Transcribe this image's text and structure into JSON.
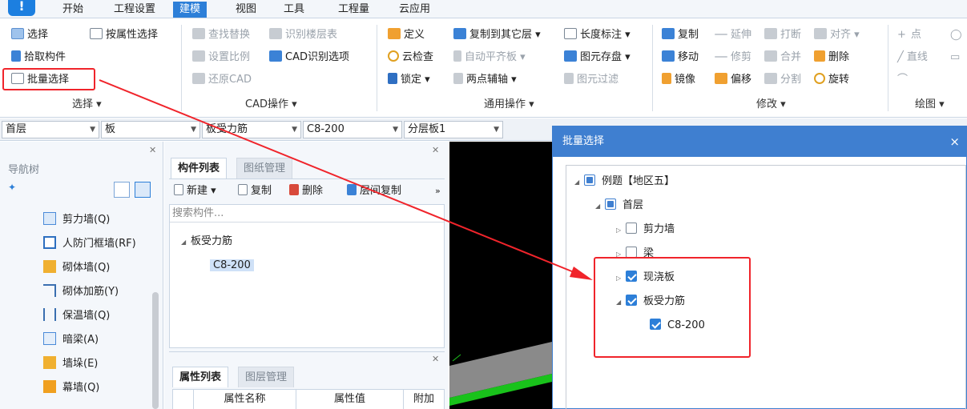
{
  "menu": {
    "logo": "!",
    "items": [
      "开始",
      "工程设置",
      "建模",
      "视图",
      "工具",
      "工程量",
      "云应用"
    ],
    "active_index": 2
  },
  "ribbon": {
    "select_group": {
      "select": "选择",
      "by_attr": "按属性选择",
      "pick": "拾取构件",
      "batch": "批量选择",
      "label": "选择 ▾"
    },
    "cad_group": {
      "find_replace": "查找替换",
      "recognize_floor": "识别楼层表",
      "set_scale": "设置比例",
      "cad_options": "CAD识别选项",
      "restore_cad": "还原CAD",
      "label": "CAD操作 ▾"
    },
    "common_group": {
      "define": "定义",
      "copy_to_floor": "复制到其它层 ▾",
      "length_mark": "长度标注 ▾",
      "cloud_check": "云检查",
      "auto_level": "自动平齐板 ▾",
      "save_element": "图元存盘 ▾",
      "lock": "锁定 ▾",
      "two_point_axis": "两点辅轴 ▾",
      "element_filter": "图元过滤",
      "label": "通用操作 ▾"
    },
    "modify_group": {
      "copy": "复制",
      "extend": "延伸",
      "break": "打断",
      "align": "对齐 ▾",
      "move": "移动",
      "trim": "修剪",
      "merge": "合并",
      "delete": "删除",
      "mirror": "镜像",
      "offset": "偏移",
      "split": "分割",
      "rotate": "旋转",
      "label": "修改 ▾"
    },
    "draw_group": {
      "point": "点",
      "line": "直线",
      "label": "绘图 ▾"
    }
  },
  "selectors": {
    "floor": "首层",
    "category": "板",
    "type": "板受力筋",
    "spec": "C8-200",
    "sub": "分层板1"
  },
  "nav": {
    "title": "导航树",
    "items": [
      {
        "label": "剪力墙(Q)"
      },
      {
        "label": "人防门框墙(RF)"
      },
      {
        "label": "砌体墙(Q)"
      },
      {
        "label": "砌体加筋(Y)"
      },
      {
        "label": "保温墙(Q)"
      },
      {
        "label": "暗梁(A)"
      },
      {
        "label": "墙垛(E)"
      },
      {
        "label": "幕墙(Q)"
      }
    ]
  },
  "components": {
    "tab_active": "构件列表",
    "tab_inactive": "图纸管理",
    "new": "新建 ▾",
    "copy": "复制",
    "delete": "删除",
    "floor_copy": "层间复制",
    "more": "»",
    "search_placeholder": "搜索构件...",
    "tree_parent": "板受力筋",
    "tree_leaf": "C8-200"
  },
  "properties": {
    "tab_active": "属性列表",
    "tab_inactive": "图层管理",
    "col_name": "属性名称",
    "col_value": "属性值",
    "col_extra": "附加"
  },
  "dialog": {
    "title": "批量选择",
    "close": "×",
    "tree": [
      {
        "label": "例题【地区五】"
      },
      {
        "label": "首层"
      },
      {
        "label": "剪力墙"
      },
      {
        "label": "梁"
      },
      {
        "label": "现浇板"
      },
      {
        "label": "板受力筋"
      },
      {
        "label": "C8-200"
      }
    ]
  },
  "colors": {
    "accent": "#2d7fd8",
    "annotation": "#f0242b"
  }
}
